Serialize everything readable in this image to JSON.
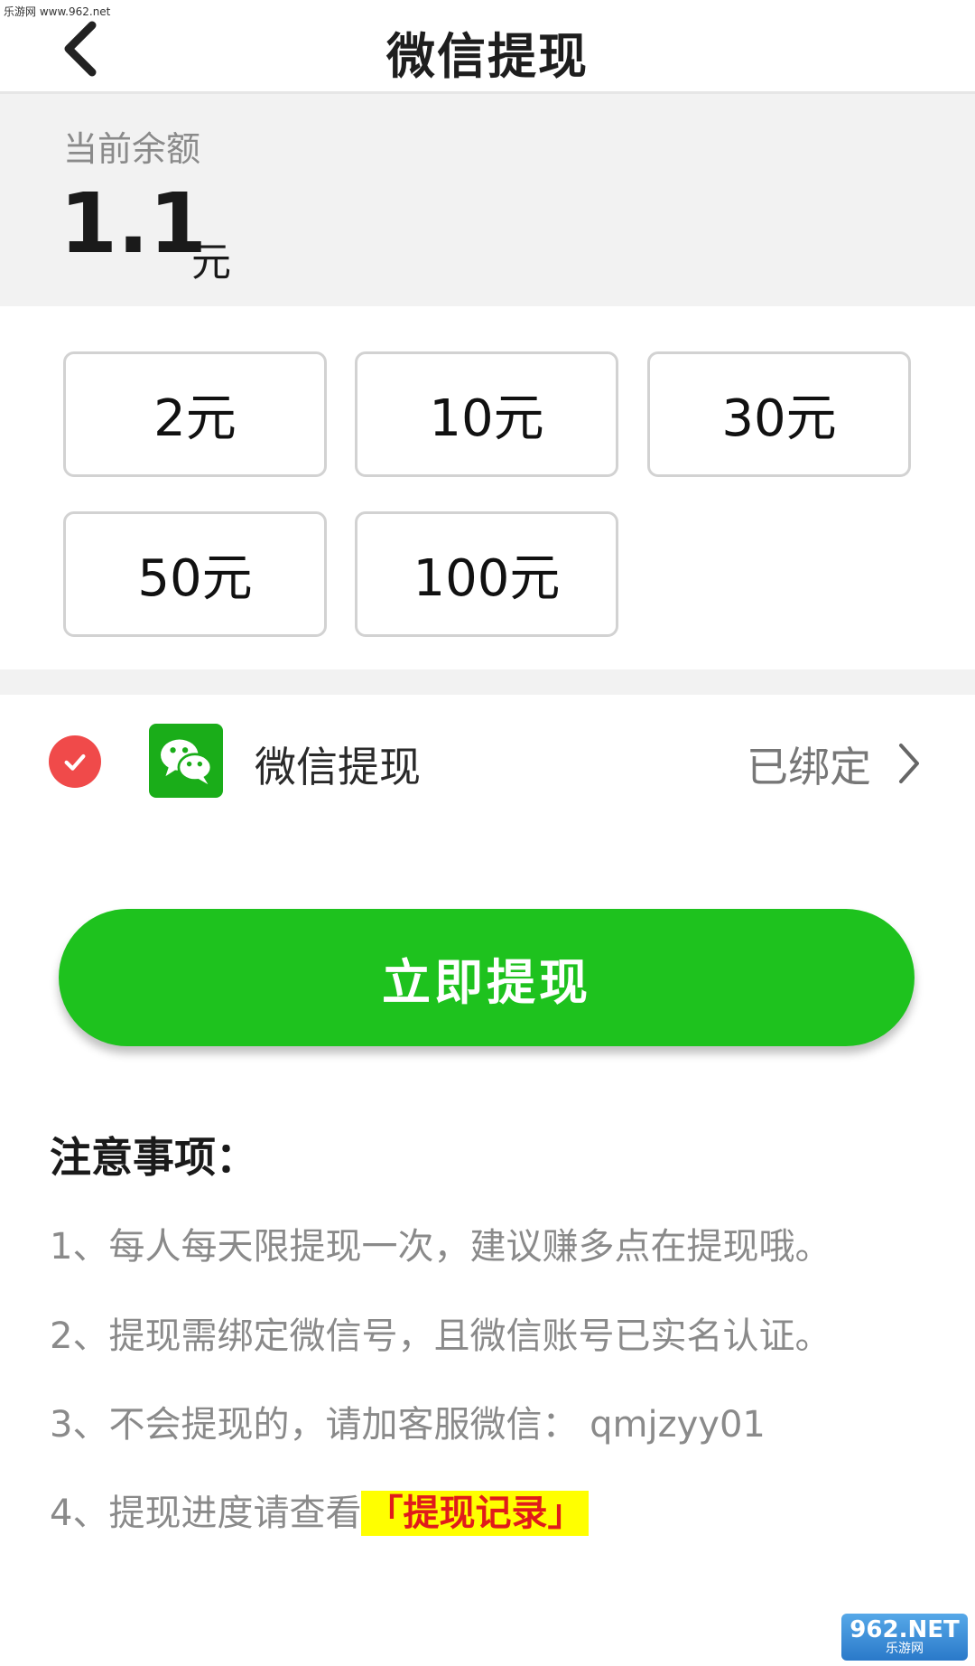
{
  "watermark": {
    "top_text": "乐游网 www.962.net",
    "logo_text": "962.NET",
    "logo_sub": "乐游网"
  },
  "header": {
    "title": "微信提现"
  },
  "balance": {
    "label": "当前余额",
    "amount": "1.1",
    "unit": "元"
  },
  "amounts": [
    {
      "label": "2元"
    },
    {
      "label": "10元"
    },
    {
      "label": "30元"
    },
    {
      "label": "50元"
    },
    {
      "label": "100元"
    }
  ],
  "payment": {
    "label": "微信提现",
    "status": "已绑定",
    "selected": true
  },
  "withdraw_button": {
    "label": "立即提现"
  },
  "notes": {
    "title": "注意事项：",
    "items": [
      "1、每人每天限提现一次，建议赚多点在提现哦。",
      "2、提现需绑定微信号，且微信账号已实名认证。",
      "3、不会提现的，请加客服微信： qmjzyy01",
      "4、提现进度请查看"
    ],
    "link": "「提现记录」"
  },
  "colors": {
    "primary_green": "#1ec21e",
    "wechat_green": "#1aad19",
    "check_red": "#f04a4a",
    "link_red": "#e01b1b",
    "highlight_yellow": "#ffff00"
  }
}
